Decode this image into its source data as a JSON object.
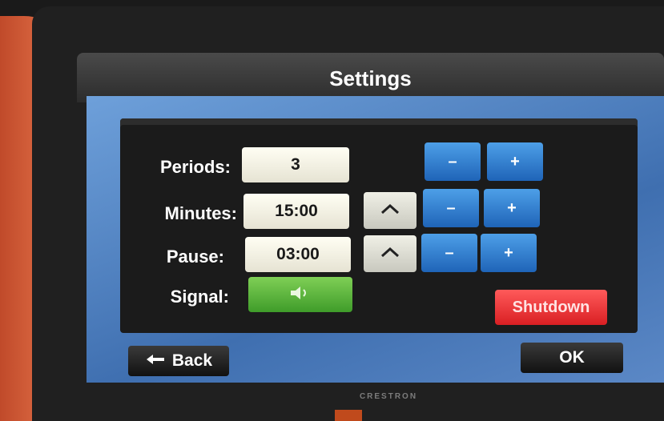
{
  "title": "Settings",
  "brand": "CRESTRON",
  "settings": {
    "periods": {
      "label": "Periods:",
      "value": "3"
    },
    "minutes": {
      "label": "Minutes:",
      "value": "15:00"
    },
    "pause": {
      "label": "Pause:",
      "value": "03:00"
    },
    "signal": {
      "label": "Signal:"
    }
  },
  "buttons": {
    "minus": "–",
    "plus": "+",
    "shutdown": "Shutdown",
    "back": "Back",
    "ok": "OK"
  },
  "colors": {
    "panel_blue": "#3f6fb0",
    "button_blue": "#1f64b8",
    "signal_green": "#4caf35",
    "shutdown_red": "#e02a2e"
  },
  "icons": [
    "speaker-icon",
    "chevron-up-icon",
    "back-arrow-icon"
  ]
}
